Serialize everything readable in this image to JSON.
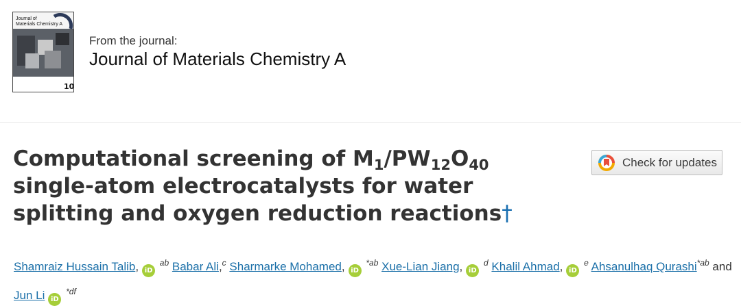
{
  "header": {
    "cover": {
      "title": "Journal of\nMaterials Chemistry A",
      "issue_mark": "10"
    },
    "from_label": "From the journal:",
    "journal_name": "Journal of Materials Chemistry A"
  },
  "article": {
    "title_part1": "Computational screening of M",
    "title_sub1": "1",
    "title_part2": "/PW",
    "title_sub2": "12",
    "title_part3": "O",
    "title_sub3": "40",
    "title_part4": " single-atom electrocatalysts for water splitting and oxygen reduction reactions",
    "title_dagger": "†",
    "check_updates_label": "Check for updates",
    "orcid_label": "iD",
    "conjunction": "and",
    "authors": [
      {
        "name": "Shamraiz Hussain Talib",
        "orcid": true,
        "aff": "ab"
      },
      {
        "name": "Babar Ali",
        "orcid": false,
        "aff": "c"
      },
      {
        "name": "Sharmarke Mohamed",
        "orcid": true,
        "aff": "*ab"
      },
      {
        "name": "Xue-Lian Jiang",
        "orcid": true,
        "aff": "d"
      },
      {
        "name": "Khalil Ahmad",
        "orcid": true,
        "aff": "e"
      },
      {
        "name": "Ahsanulhaq Qurashi",
        "orcid": false,
        "aff": "*ab"
      },
      {
        "name": "Jun Li",
        "orcid": true,
        "aff": "*df"
      }
    ]
  },
  "colors": {
    "link": "#1a6fa8",
    "orcid": "#a6ce39",
    "title": "#333333"
  }
}
